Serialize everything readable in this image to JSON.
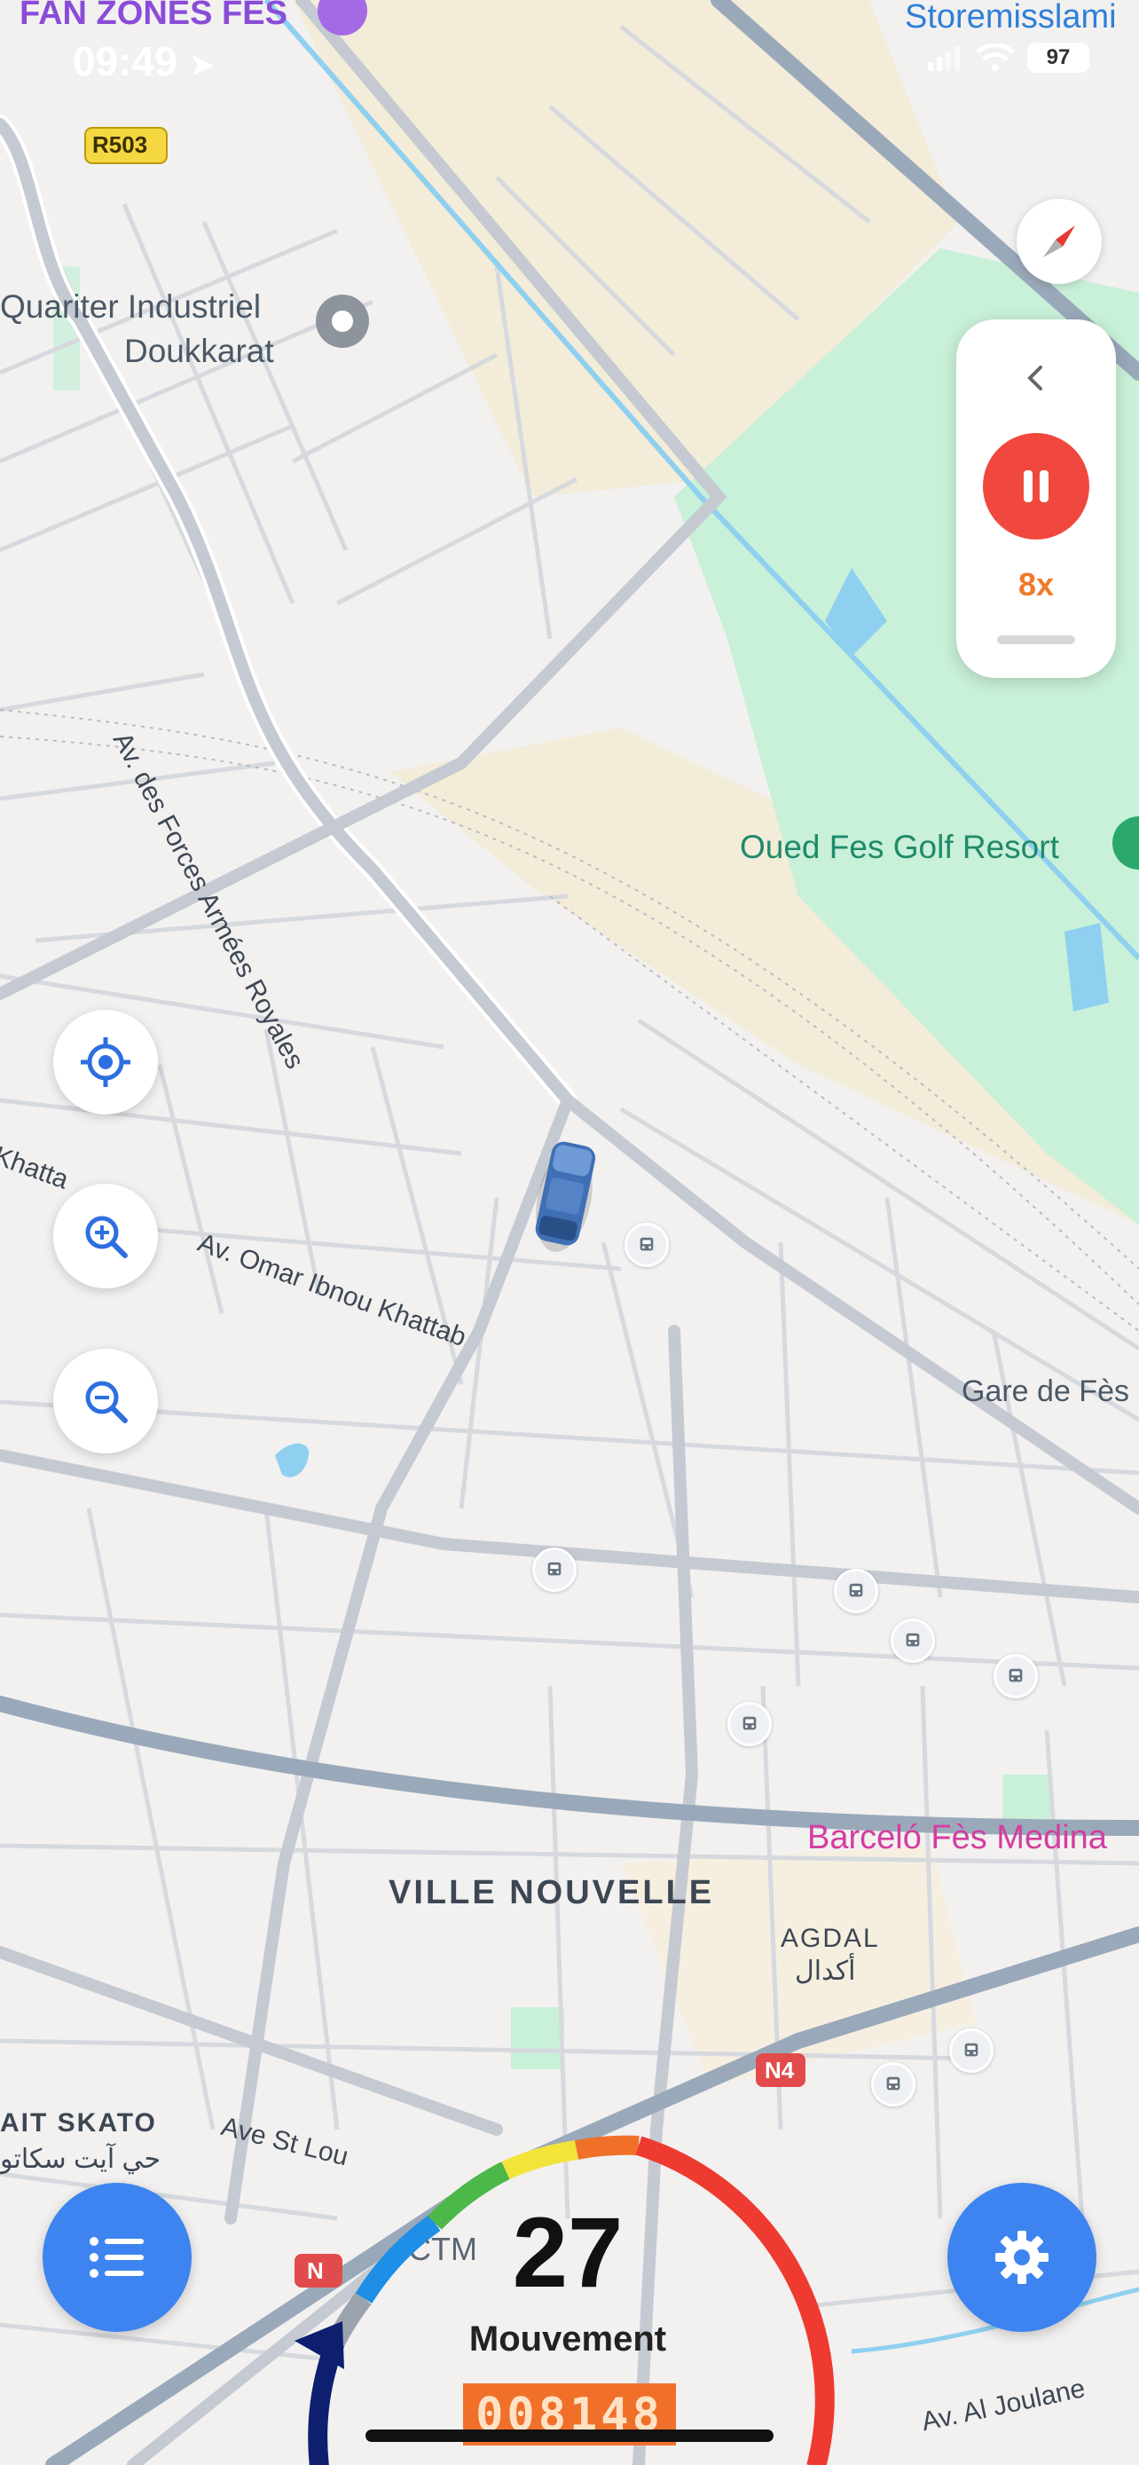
{
  "status_bar": {
    "time": "09:49",
    "battery": "97"
  },
  "map": {
    "places": {
      "fan_zones": "FAN ZONES FES",
      "storemisslami": "Storemisslami",
      "industrial_line1": "Quariter Industriel",
      "industrial_line2": "Doukkarat",
      "golf_resort": "Oued Fes Golf Resort",
      "gare": "Gare de Fès",
      "barcelo": "Barceló Fès Medina",
      "ville_nouvelle": "VILLE NOUVELLE",
      "agdal": "AGDAL",
      "agdal_ar": "أكدال",
      "ait_skato": "AIT SKATO",
      "ait_skato_ar": "حي آيت سكاتو",
      "ctm": "CTM"
    },
    "streets": {
      "forces_armees": "Av. des Forces Armées Royales",
      "omar_ibnou_khattab": "Av. Omar Ibnou Khattab",
      "khatta_fragment": "Khatta",
      "ave_st_louis": "Ave St Lou",
      "av_al_joulane": "Av. Al Joulane"
    },
    "route_badges": {
      "r503": "R503",
      "n4": "N4",
      "n_small": "N"
    }
  },
  "playback": {
    "speed": "8x"
  },
  "gauge": {
    "speed": "27",
    "status": "Mouvement",
    "odometer": "008148"
  },
  "icons": {
    "compass": "compass-icon",
    "back": "chevron-left-icon",
    "pause": "pause-icon",
    "locate": "crosshair-locate-icon",
    "zoom_in": "zoom-in-icon",
    "zoom_out": "zoom-out-icon",
    "list": "list-icon",
    "settings": "gear-icon",
    "vehicle": "van-icon",
    "bus_stop": "bus-stop-icon"
  },
  "colors": {
    "pause_button": "#f0483e",
    "speed_label": "#f07a2a",
    "fab_blue": "#3d84f0",
    "locate_icon": "#2e6fe0",
    "gauge_red": "#ee3a30",
    "gauge_yellow": "#f3e43a",
    "gauge_green": "#4cb84a",
    "gauge_blue": "#1e8ee6",
    "odometer_bg": "#f0702a",
    "park_green": "#c9f0d8"
  }
}
